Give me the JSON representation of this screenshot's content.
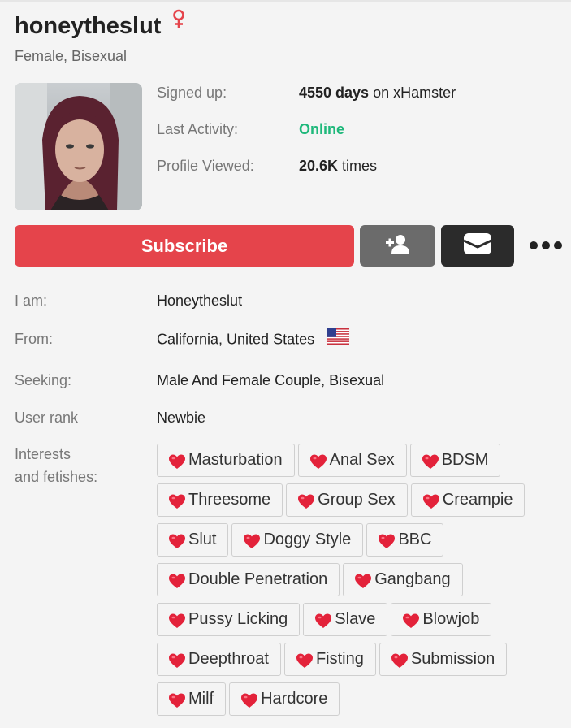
{
  "profile": {
    "username": "honeytheslut",
    "gender_icon": "female-symbol-icon",
    "subtitle": "Female, Bisexual",
    "avatar_alt": "profile photo"
  },
  "stats": [
    {
      "label": "Signed up:",
      "value_bold": "4550 days",
      "value_rest": " on xHamster"
    },
    {
      "label": "Last Activity:",
      "value_status": "Online"
    },
    {
      "label": "Profile Viewed:",
      "value_bold": "20.6K",
      "value_rest": " times"
    }
  ],
  "actions": {
    "subscribe_label": "Subscribe",
    "add_friend_icon": "add-friend-icon",
    "message_icon": "message-icon",
    "more_icon": "more-options-icon"
  },
  "info": {
    "i_am_label": "I am:",
    "i_am_value": "Honeytheslut",
    "from_label": "From:",
    "from_value": "California, United States",
    "seeking_label": "Seeking:",
    "seeking_value": "Male And Female Couple, Bisexual",
    "rank_label": "User rank",
    "rank_value": "Newbie",
    "interests_label_line1": "Interests",
    "interests_label_line2": "and fetishes:"
  },
  "interests": [
    [
      "Masturbation",
      "Anal Sex",
      "BDSM"
    ],
    [
      "Threesome",
      "Group Sex",
      "Creampie"
    ],
    [
      "Slut",
      "Doggy Style",
      "BBC"
    ],
    [
      "Double Penetration",
      "Gangbang"
    ],
    [
      "Pussy Licking",
      "Slave",
      "Blowjob"
    ],
    [
      "Deepthroat",
      "Fisting",
      "Submission"
    ],
    [
      "Milf",
      "Hardcore"
    ]
  ],
  "colors": {
    "accent": "#e5444b",
    "online": "#1fb87b",
    "heart": "#e3223a"
  }
}
